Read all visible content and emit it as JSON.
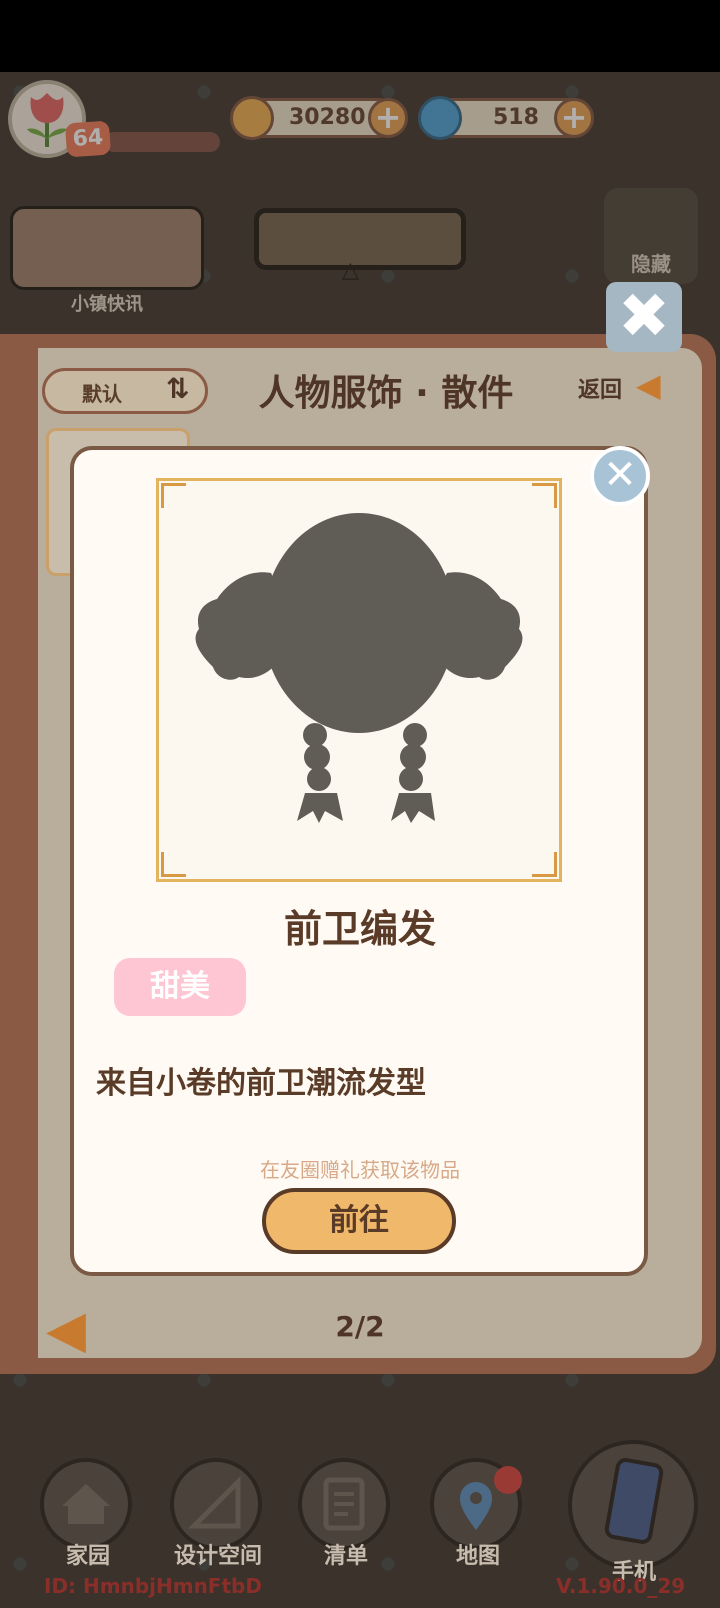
{
  "hud": {
    "level": "64",
    "coins": "30280",
    "gems": "518",
    "add_label": "+"
  },
  "widgets": {
    "news_label": "小镇快讯",
    "hide_label": "隐藏",
    "close_glyph": "✖"
  },
  "panel": {
    "title": "人物服饰 · 散件",
    "sort_label": "默认",
    "sort_icon": "⇅",
    "back_label": "返回",
    "back_icon": "◀",
    "prev_icon": "◀",
    "page": "2/2"
  },
  "popup": {
    "close_glyph": "✕",
    "item_name": "前卫编发",
    "tag": "甜美",
    "description": "来自小卷的前卫潮流发型",
    "hint": "在友圈赠礼获取该物品",
    "goto_label": "前往"
  },
  "nav": {
    "items": [
      {
        "label": "家园",
        "icon": "house-icon"
      },
      {
        "label": "设计空间",
        "icon": "ruler-icon"
      },
      {
        "label": "清单",
        "icon": "checklist-icon"
      },
      {
        "label": "地图",
        "icon": "map-pin-icon"
      },
      {
        "label": "手机",
        "icon": "phone-icon"
      }
    ]
  },
  "footer": {
    "id": "ID: HmnbjHmnFtbD",
    "version": "V.1.90.0_29"
  },
  "colors": {
    "accent": "#f0b86a",
    "text_brown": "#5a3b27",
    "tag_pink": "#fdc6d2"
  }
}
